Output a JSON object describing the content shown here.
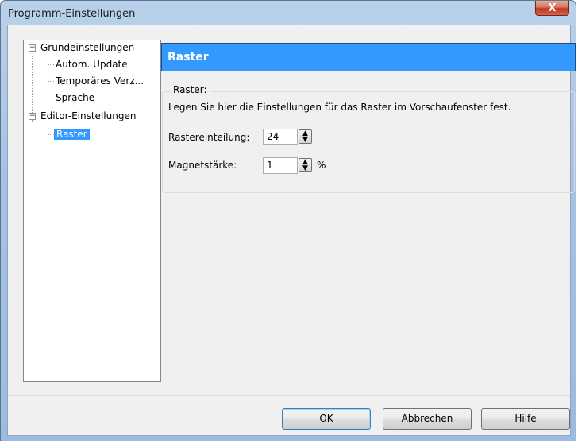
{
  "window": {
    "title": "Programm-Einstellungen",
    "close_label": "X"
  },
  "tree": {
    "expander_symbol": "−",
    "items": [
      {
        "label": "Grundeinstellungen"
      },
      {
        "label": "Autom. Update"
      },
      {
        "label": "Temporäres Verz..."
      },
      {
        "label": "Sprache"
      },
      {
        "label": "Editor-Einstellungen"
      },
      {
        "label": "Raster"
      }
    ]
  },
  "panel": {
    "header": "Raster",
    "group_title": "Raster:",
    "description": "Legen Sie hier die Einstellungen für das Raster im Vorschaufenster fest.",
    "fields": [
      {
        "label": "Rastereinteilung:",
        "value": "24",
        "unit": ""
      },
      {
        "label": "Magnetstärke:",
        "value": "1",
        "unit": "%"
      }
    ]
  },
  "buttons": {
    "ok": "OK",
    "cancel": "Abbrechen",
    "help": "Hilfe"
  },
  "colors": {
    "accent": "#3399ff",
    "dialog_bg": "#f0f0f0",
    "close_button": "#c0391e"
  }
}
